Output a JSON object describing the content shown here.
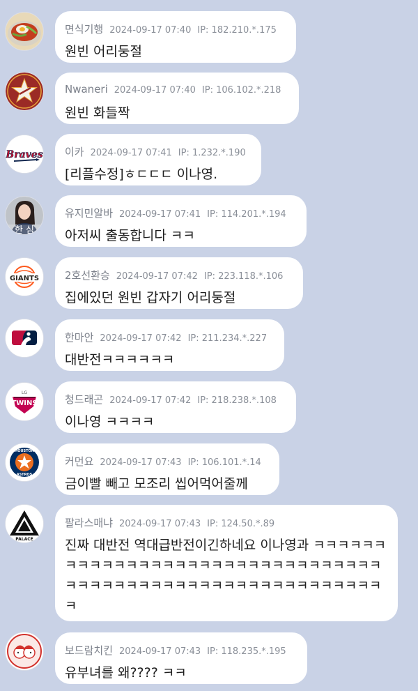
{
  "comments": [
    {
      "nick": "면식기행",
      "date": "2024-09-17 07:40",
      "ip": "IP: 182.210.*.175",
      "text": "원빈 어리둥절",
      "avatar_icon": "noodle-bowl-icon"
    },
    {
      "nick": "Nwaneri",
      "date": "2024-09-17 07:40",
      "ip": "IP: 106.102.*.218",
      "text": "원빈 화들짝",
      "avatar_icon": "astros-star-icon"
    },
    {
      "nick": "이카",
      "date": "2024-09-17 07:41",
      "ip": "IP: 1.232.*.190",
      "text": "[리플수정]ㅎㄷㄷㄷ 이나영.",
      "avatar_icon": "braves-logo-icon"
    },
    {
      "nick": "유지민알바",
      "date": "2024-09-17 07:41",
      "ip": "IP: 114.201.*.194",
      "text": "아저씨 출동합니다 ㅋㅋ",
      "avatar_icon": "person-photo-icon"
    },
    {
      "nick": "2호선환승",
      "date": "2024-09-17 07:42",
      "ip": "IP: 223.118.*.106",
      "text": "집에있던 원빈 갑자기 어리둥절",
      "avatar_icon": "giants-logo-icon"
    },
    {
      "nick": "한마안",
      "date": "2024-09-17 07:42",
      "ip": "IP: 211.234.*.227",
      "text": "대반전ㅋㅋㅋㅋㅋㅋ",
      "avatar_icon": "mlb-logo-icon"
    },
    {
      "nick": "청드래곤",
      "date": "2024-09-17 07:42",
      "ip": "IP: 218.238.*.108",
      "text": "이나영 ㅋㅋㅋㅋ",
      "avatar_icon": "twins-logo-icon"
    },
    {
      "nick": "커먼요",
      "date": "2024-09-17 07:43",
      "ip": "IP: 106.101.*.14",
      "text": "금이빨 빼고 모조리 씹어먹어줄께",
      "avatar_icon": "houston-astros-logo-icon"
    },
    {
      "nick": "팔라스매냐",
      "date": "2024-09-17 07:43",
      "ip": "IP: 124.50.*.89",
      "text": "진짜 대반전 역대급반전이긴하네요 이나영과 ㅋㅋㅋㅋㅋㅋㅋㅋㅋㅋㅋㅋㅋㅋㅋㅋㅋㅋㅋㅋㅋㅋㅋㅋㅋㅋㅋㅋㅋㅋㅋㅋㅋㅋㅋㅋㅋㅋㅋㅋㅋㅋㅋㅋㅋㅋㅋㅋㅋㅋㅋㅋㅋㅋㅋㅋㅋㅋㅋ",
      "avatar_icon": "palace-triangle-icon"
    },
    {
      "nick": "보드람치킨",
      "date": "2024-09-17 07:43",
      "ip": "IP: 118.235.*.195",
      "text": "유부녀를 왜???? ㅋㅋ",
      "avatar_icon": "chicken-logo-icon"
    }
  ],
  "avatar_logo_text": {
    "braves": "Braves",
    "giants": "GIANTS",
    "twins_small": "LG",
    "twins": "TWINS",
    "houston": "HOUSTON",
    "astros": "ASTROS",
    "palace": "PALACE",
    "person": "한 심"
  }
}
